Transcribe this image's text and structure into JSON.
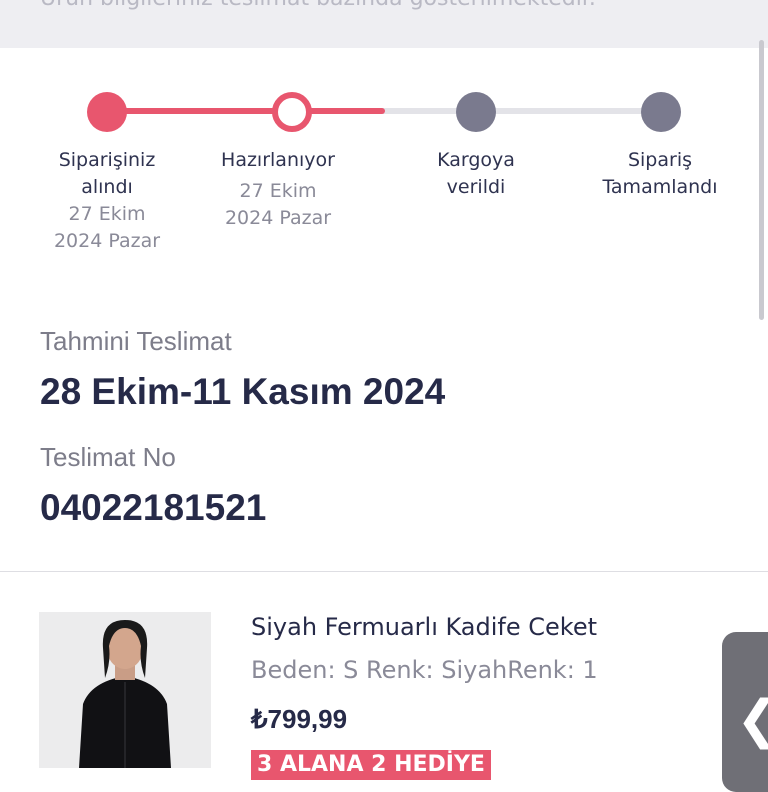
{
  "banner": {
    "text": "Ürün bilgileriniz teslimat bazında gösterilmektedir."
  },
  "steps": [
    {
      "title_line1": "Siparişiniz",
      "title_line2": "alındı",
      "date_line1": "27 Ekim",
      "date_line2": "2024 Pazar",
      "state": "done"
    },
    {
      "title_line1": "Hazırlanıyor",
      "title_line2": "",
      "date_line1": "27 Ekim",
      "date_line2": "2024 Pazar",
      "state": "current"
    },
    {
      "title_line1": "Kargoya",
      "title_line2": "verildi",
      "date_line1": "",
      "date_line2": "",
      "state": "pending"
    },
    {
      "title_line1": "Sipariş",
      "title_line2": "Tamamlandı",
      "date_line1": "",
      "date_line2": "",
      "state": "pending"
    }
  ],
  "delivery": {
    "estimate_label": "Tahmini Teslimat",
    "estimate_value": "28 Ekim-11 Kasım 2024",
    "number_label": "Teslimat No",
    "number_value": "04022181521"
  },
  "product": {
    "name": "Siyah Fermuarlı Kadife Ceket",
    "variant": "Beden: S Renk: SiyahRenk: 1",
    "price": "₺799,99",
    "promo": "3 ALANA 2 HEDİYE"
  },
  "side_tab": {
    "icon": "chevron-left-icon",
    "glyph": "❮"
  },
  "colors": {
    "accent": "#e8566e",
    "pending": "#7a7a8e",
    "text_dark": "#262a48"
  }
}
